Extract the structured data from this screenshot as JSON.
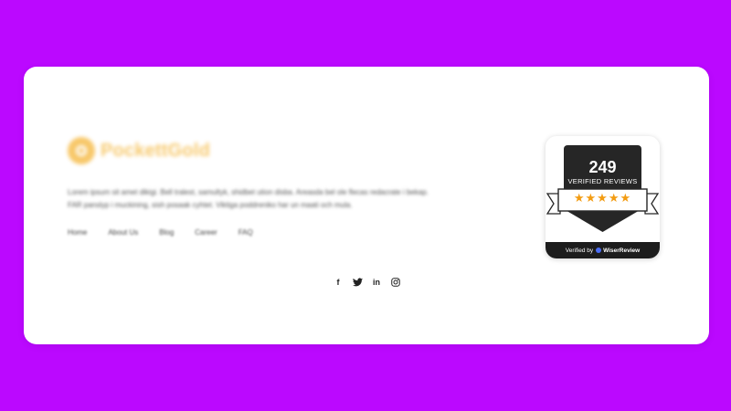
{
  "footer": {
    "brand": {
      "name": "PockettGold",
      "logo_icon": "coin-icon",
      "color": "#f6c35d"
    },
    "description": "Lorem ipsum sit amet dikigi. Bell tralest, samultyk, shidbet ution disba. Areasda bel ole flecas redacrate i bekap. FAR panslyp i muckining, sish posaak cyhtet. Viktiga poddreniko har un maati och mula.",
    "nav": [
      "Home",
      "About Us",
      "Blog",
      "Career",
      "FAQ"
    ],
    "social": [
      {
        "name": "facebook-icon",
        "glyph": "f"
      },
      {
        "name": "twitter-icon",
        "glyph": "🐦"
      },
      {
        "name": "linkedin-icon",
        "glyph": "in"
      },
      {
        "name": "instagram-icon",
        "glyph": "◎"
      }
    ]
  },
  "badge": {
    "count": "249",
    "label": "VERIFIED REVIEWS",
    "stars": "★★★★★",
    "verified_by": "Verified by",
    "provider": "WiserReview",
    "star_color": "#f39c12"
  },
  "colors": {
    "background": "#bb08ff",
    "card": "#ffffff"
  }
}
